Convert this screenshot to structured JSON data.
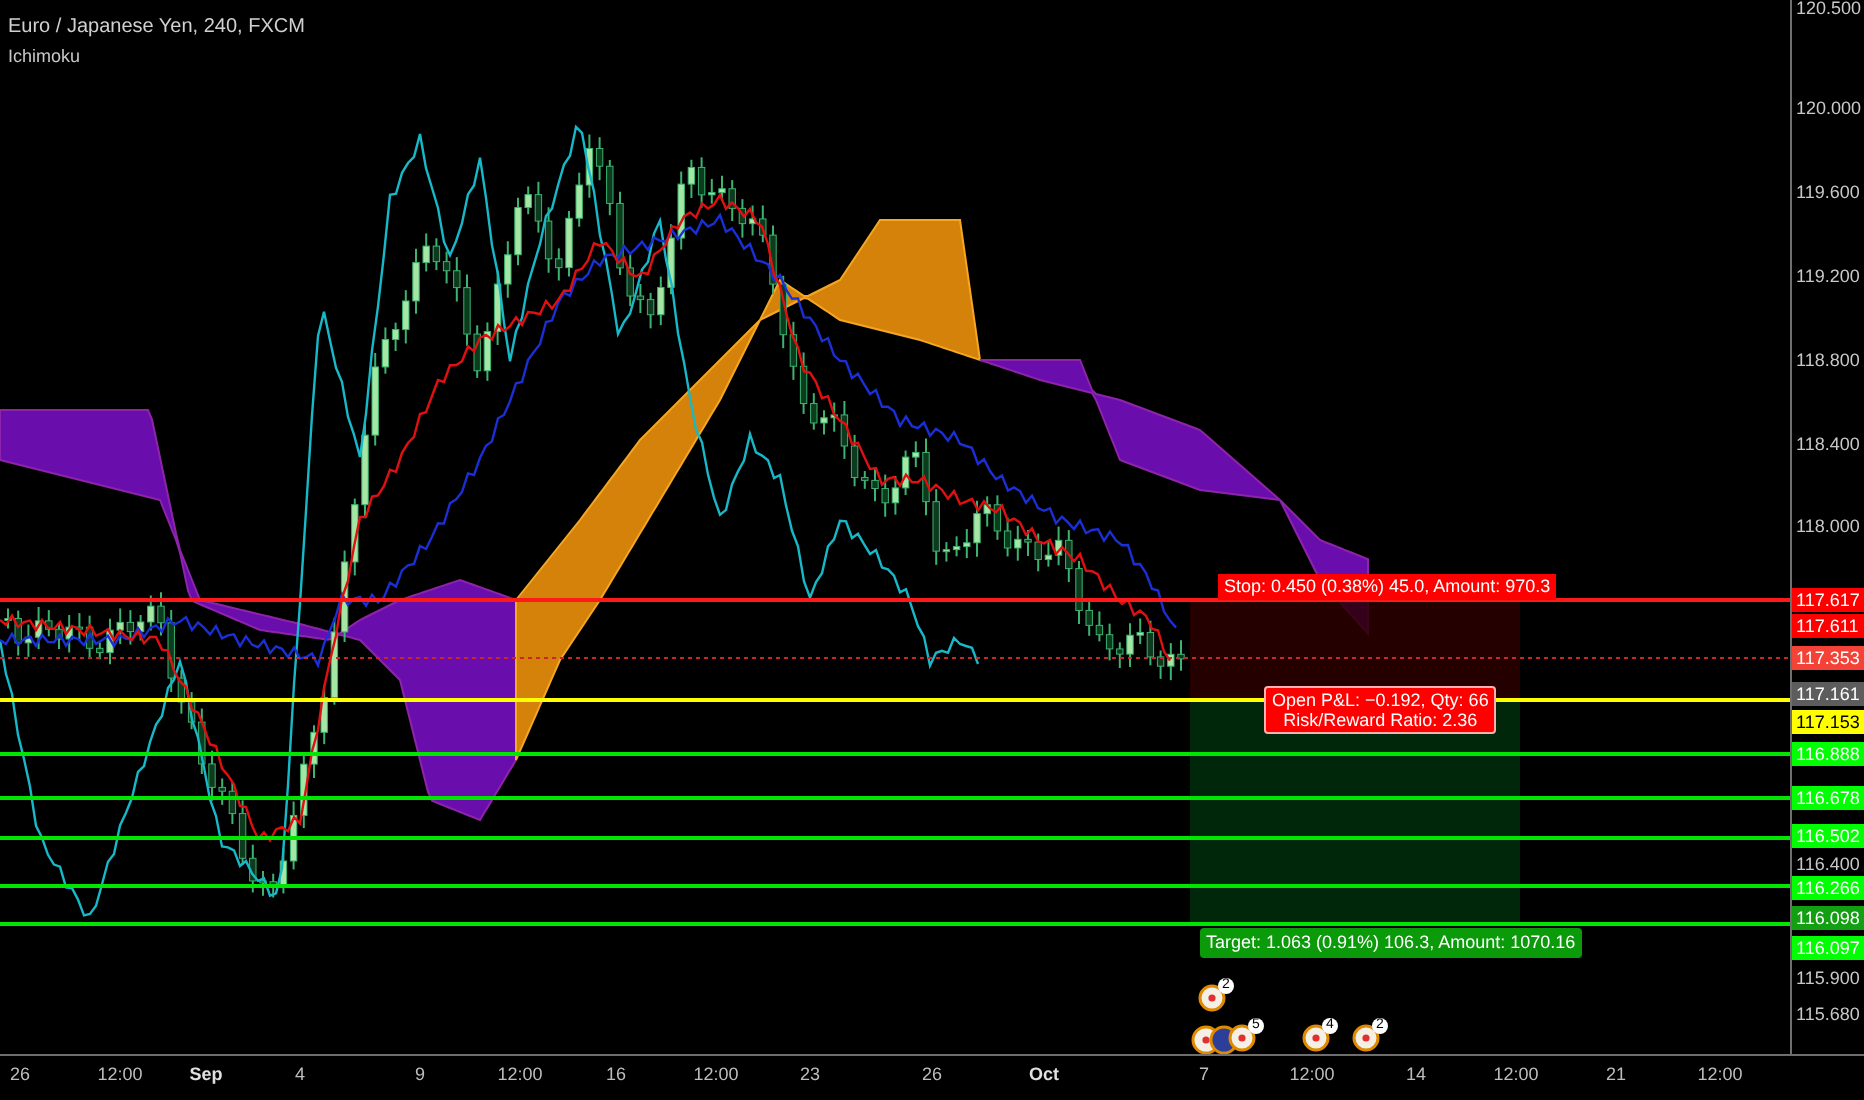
{
  "legend": {
    "title": "Euro / Japanese Yen, 240, FXCM",
    "indicator": "Ichimoku"
  },
  "position": {
    "stop_label": "Stop: 0.450 (0.38%) 45.0, Amount: 970.3",
    "pnl_lines": [
      "Open P&L: −0.192, Qty: 66",
      "Risk/Reward Ratio: 2.36"
    ],
    "target_label": "Target: 1.063 (0.91%) 106.3, Amount: 1070.16"
  },
  "events": [
    {
      "count": "2"
    },
    {
      "count": "5"
    },
    {
      "count": "4"
    },
    {
      "count": "2"
    }
  ],
  "price_scale": [
    {
      "label": "120.500",
      "kind": "tick"
    },
    {
      "label": "120.000",
      "kind": "tick"
    },
    {
      "label": "119.600",
      "kind": "tick"
    },
    {
      "label": "119.200",
      "kind": "tick"
    },
    {
      "label": "118.800",
      "kind": "tick"
    },
    {
      "label": "118.400",
      "kind": "tick"
    },
    {
      "label": "118.000",
      "kind": "tick"
    },
    {
      "label": "117.617",
      "kind": "badge",
      "color": "#ff0000"
    },
    {
      "label": "117.611",
      "kind": "badge",
      "color": "#ff0000"
    },
    {
      "label": "117.353",
      "kind": "badge",
      "color": "#f44336"
    },
    {
      "label": "117.161",
      "kind": "badge",
      "color": "#5d5d5d"
    },
    {
      "label": "117.153",
      "kind": "badge",
      "color": "#ffff00"
    },
    {
      "label": "116.888",
      "kind": "badge",
      "color": "#00ff00"
    },
    {
      "label": "116.678",
      "kind": "badge",
      "color": "#00ff00"
    },
    {
      "label": "116.502",
      "kind": "badge",
      "color": "#00ff00"
    },
    {
      "label": "116.400",
      "kind": "tick"
    },
    {
      "label": "116.266",
      "kind": "badge",
      "color": "#00ff00"
    },
    {
      "label": "116.098",
      "kind": "badge",
      "color": "#12a012"
    },
    {
      "label": "116.097",
      "kind": "badge",
      "color": "#00ff00"
    },
    {
      "label": "115.900",
      "kind": "tick"
    },
    {
      "label": "115.680",
      "kind": "tick"
    }
  ],
  "time_axis": [
    {
      "label": "26",
      "kind": "day"
    },
    {
      "label": "12:00",
      "kind": "time"
    },
    {
      "label": "Sep",
      "kind": "month"
    },
    {
      "label": "4",
      "kind": "day"
    },
    {
      "label": "9",
      "kind": "day"
    },
    {
      "label": "12:00",
      "kind": "time"
    },
    {
      "label": "16",
      "kind": "day"
    },
    {
      "label": "12:00",
      "kind": "time"
    },
    {
      "label": "23",
      "kind": "day"
    },
    {
      "label": "26",
      "kind": "day"
    },
    {
      "label": "Oct",
      "kind": "month"
    },
    {
      "label": "7",
      "kind": "day"
    },
    {
      "label": "12:00",
      "kind": "time"
    },
    {
      "label": "14",
      "kind": "day"
    },
    {
      "label": "12:00",
      "kind": "time"
    },
    {
      "label": "21",
      "kind": "day"
    },
    {
      "label": "12:00",
      "kind": "time"
    }
  ]
}
